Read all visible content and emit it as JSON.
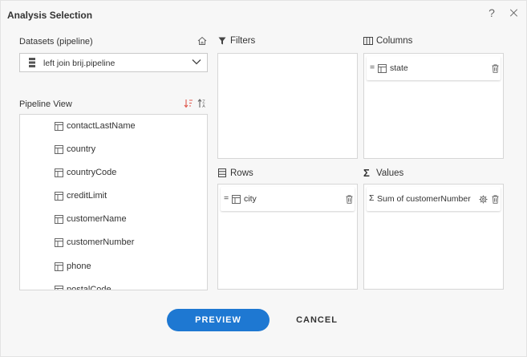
{
  "dialog": {
    "title": "Analysis Selection",
    "help_label": "?"
  },
  "datasets": {
    "label": "Datasets (pipeline)",
    "selected": "left join brij.pipeline"
  },
  "pipeline_view": {
    "label": "Pipeline View",
    "items": [
      "contactLastName",
      "country",
      "countryCode",
      "creditLimit",
      "customerName",
      "customerNumber",
      "phone",
      "postalCode"
    ]
  },
  "filters": {
    "label": "Filters"
  },
  "columns": {
    "label": "Columns",
    "chips": [
      {
        "prefix": "=",
        "text": "state"
      }
    ]
  },
  "rows": {
    "label": "Rows",
    "chips": [
      {
        "prefix": "=",
        "text": "city"
      }
    ]
  },
  "values": {
    "label": "Values",
    "chips": [
      {
        "prefix": "Σ",
        "text": "Sum of customerNumber"
      }
    ]
  },
  "actions": {
    "preview": "PREVIEW",
    "cancel": "CANCEL"
  },
  "colors": {
    "accent": "#1e78d2",
    "sort_icon": "#e05a4f"
  },
  "icons": {
    "title_help": "help-icon",
    "title_close": "close-icon",
    "home": "home-icon",
    "database": "database-icon",
    "dropdown": "chevron-down-icon",
    "sort_desc": "sort-descending-icon",
    "sort_alpha": "sort-alpha-icon",
    "filter": "filter-icon",
    "columns": "columns-icon",
    "rows": "rows-icon",
    "values": "sigma-icon",
    "table_field": "table-icon",
    "delete": "trash-icon",
    "settings": "gear-icon"
  }
}
